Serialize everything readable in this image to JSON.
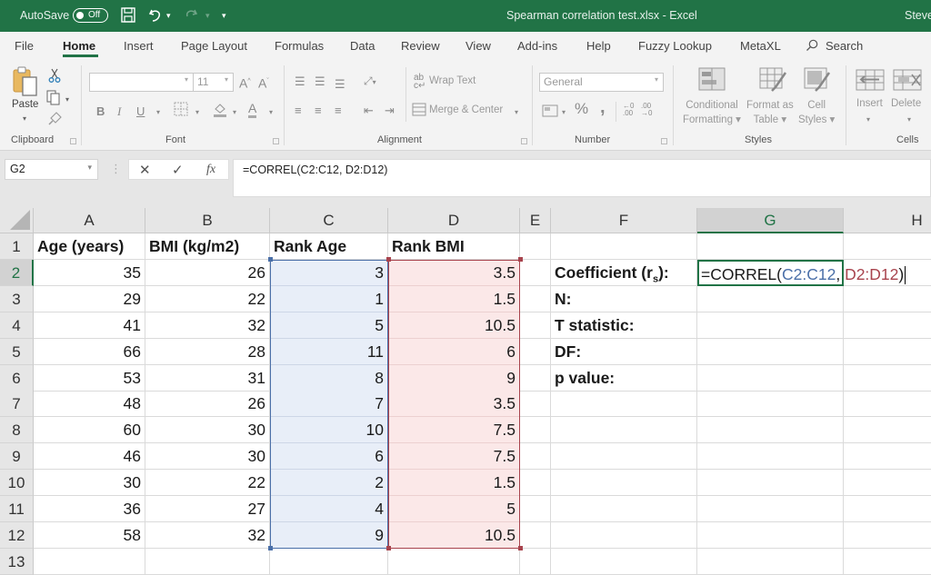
{
  "titlebar": {
    "autosave_label": "AutoSave",
    "autosave_state": "Off",
    "document_title": "Spearman correlation test.xlsx  -  Excel",
    "user": "Steve",
    "colors": {
      "brand": "#217346"
    }
  },
  "tabs": [
    {
      "label": "File"
    },
    {
      "label": "Home",
      "active": true
    },
    {
      "label": "Insert"
    },
    {
      "label": "Page Layout"
    },
    {
      "label": "Formulas"
    },
    {
      "label": "Data"
    },
    {
      "label": "Review"
    },
    {
      "label": "View"
    },
    {
      "label": "Add-ins"
    },
    {
      "label": "Help"
    },
    {
      "label": "Fuzzy Lookup"
    },
    {
      "label": "MetaXL"
    },
    {
      "label": "Search",
      "icon": "search-icon"
    }
  ],
  "ribbon": {
    "clipboard": {
      "label": "Clipboard",
      "paste": "Paste"
    },
    "font": {
      "label": "Font",
      "font_name": "",
      "font_size": "11",
      "bold": "B",
      "italic": "I",
      "underline": "U"
    },
    "alignment": {
      "label": "Alignment",
      "wrap_text": "Wrap Text",
      "merge_center": "Merge & Center"
    },
    "number": {
      "label": "Number",
      "format": "General",
      "percent": "%",
      "comma": ","
    },
    "styles": {
      "label": "Styles",
      "conditional_formatting": [
        "Conditional",
        "Formatting"
      ],
      "format_as_table": [
        "Format as",
        "Table"
      ],
      "cell_styles": [
        "Cell",
        "Styles"
      ]
    },
    "cells": {
      "label": "Cells",
      "insert": "Insert",
      "delete": "Delete"
    }
  },
  "formula_bar": {
    "name_box": "G2",
    "cancel": "✕",
    "enter": "✓",
    "fx": "fx",
    "formula": "=CORREL(C2:C12, D2:D12)"
  },
  "columns": [
    "A",
    "B",
    "C",
    "D",
    "E",
    "F",
    "G",
    "H"
  ],
  "rows": [
    "1",
    "2",
    "3",
    "4",
    "5",
    "6",
    "7",
    "8",
    "9",
    "10",
    "11",
    "12",
    "13"
  ],
  "table": {
    "headers": [
      "Age (years)",
      "BMI (kg/m2)",
      "Rank Age",
      "Rank BMI"
    ],
    "data": [
      [
        "35",
        "26",
        "3",
        "3.5"
      ],
      [
        "29",
        "22",
        "1",
        "1.5"
      ],
      [
        "41",
        "32",
        "5",
        "10.5"
      ],
      [
        "66",
        "28",
        "11",
        "6"
      ],
      [
        "53",
        "31",
        "8",
        "9"
      ],
      [
        "48",
        "26",
        "7",
        "3.5"
      ],
      [
        "60",
        "30",
        "10",
        "7.5"
      ],
      [
        "46",
        "30",
        "6",
        "7.5"
      ],
      [
        "30",
        "22",
        "2",
        "1.5"
      ],
      [
        "36",
        "27",
        "4",
        "5"
      ],
      [
        "58",
        "32",
        "9",
        "10.5"
      ]
    ]
  },
  "stats": {
    "labels": [
      {
        "text": "Coefficient (r",
        "sub": "s",
        "suffix": "):"
      },
      {
        "text": "N:"
      },
      {
        "text": "T statistic:"
      },
      {
        "text": "DF:"
      },
      {
        "text": "p value:"
      }
    ],
    "active_cell": {
      "ref": "G2",
      "prefix": "=CORREL(",
      "range1": "C2:C12",
      "sep": ", ",
      "range2": "D2:D12",
      "suffix": ")"
    }
  },
  "highlight_colors": {
    "range1": "#4a6fa8",
    "range2": "#a8434d"
  }
}
